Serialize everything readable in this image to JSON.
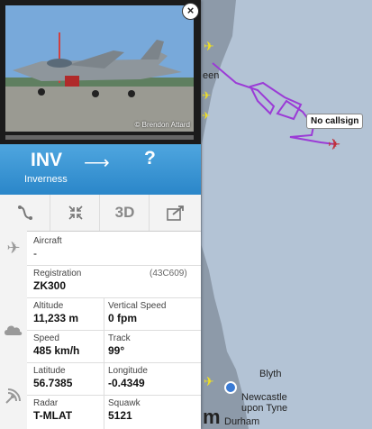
{
  "map": {
    "labels": {
      "aberdeen_fragment": "een",
      "blyth": "Blyth",
      "newcastle": "Newcastle upon Tyne",
      "durham": "Durham",
      "partial_m": "m"
    },
    "callout": "No callsign",
    "track_color": "#9b3bd6",
    "sea_color": "#b3c3d5",
    "land_color": "#8d9aa9"
  },
  "panel": {
    "photo_credit": "© Brendon Attard",
    "close_label": "×",
    "route": {
      "origin_code": "INV",
      "origin_city": "Inverness",
      "arrow": "⟶",
      "destination_code": "?"
    },
    "toolbar": {
      "route_icon": "route-icon",
      "collapse_icon": "collapse-icon",
      "three_d_label": "3D",
      "share_icon": "share-icon"
    },
    "aircraft": {
      "label": "Aircraft",
      "value": "-"
    },
    "registration": {
      "label": "Registration",
      "value": "ZK300",
      "hex": "(43C609)"
    },
    "altitude": {
      "label": "Altitude",
      "value": "11,233 m"
    },
    "vertical_speed": {
      "label": "Vertical Speed",
      "value": "0 fpm"
    },
    "speed": {
      "label": "Speed",
      "value": "485 km/h"
    },
    "track": {
      "label": "Track",
      "value": "99°"
    },
    "latitude": {
      "label": "Latitude",
      "value": "56.7385"
    },
    "longitude": {
      "label": "Longitude",
      "value": "-0.4349"
    },
    "radar": {
      "label": "Radar",
      "value": "T-MLAT"
    },
    "squawk": {
      "label": "Squawk",
      "value": "5121"
    }
  }
}
